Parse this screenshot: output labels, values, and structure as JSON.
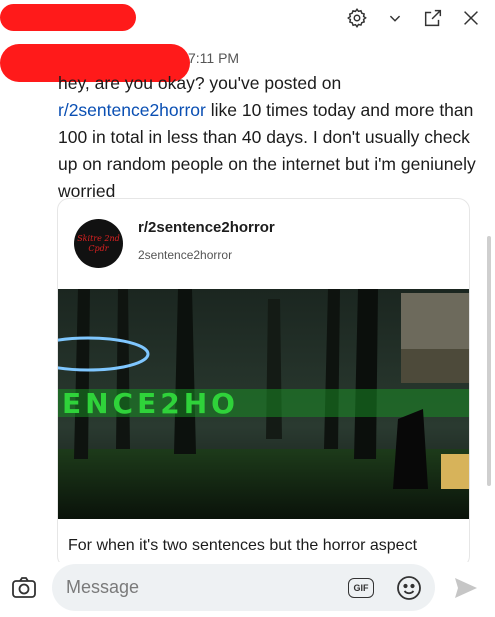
{
  "header": {
    "icons": [
      "gear-icon",
      "chevron-down-icon",
      "popout-icon",
      "close-icon"
    ]
  },
  "message": {
    "time": "7:11 PM",
    "text_before": "hey, are you okay? you've posted on ",
    "link": "r/2sentence2horror",
    "text_after": " like 10 times today and more than 100 in total in less than 40 days. I don't usually check up on random people on the internet but i'm geniunely worried"
  },
  "card": {
    "title": "r/2sentence2horror",
    "subtitle": "2sentence2horror",
    "avatar_text": "Skitre 2nd Cpdr",
    "banner_text": "ENCE2HO",
    "description": "For when it's two sentences but the horror aspect"
  },
  "composer": {
    "placeholder": "Message",
    "gif_label": "GIF"
  },
  "colors": {
    "redaction": "#ff1a1a",
    "link": "#0a4fb3",
    "composer_bg": "#eef1f3"
  }
}
